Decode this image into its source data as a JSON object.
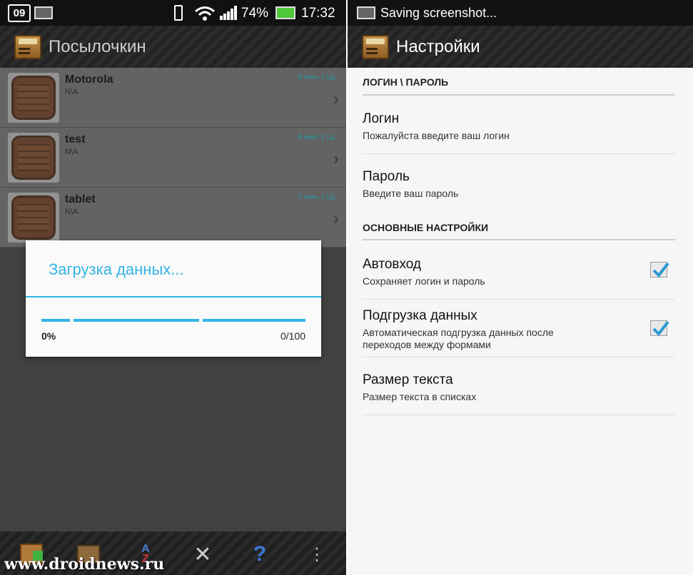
{
  "left": {
    "status": {
      "date_badge": "09",
      "battery": "74%",
      "time": "17:32"
    },
    "app_title": "Посылочкин",
    "items": [
      {
        "title": "Motorola",
        "subtitle": "N\\A",
        "time": "6 мин. | 1д."
      },
      {
        "title": "test",
        "subtitle": "N\\A",
        "time": "9 мин. | 1д."
      },
      {
        "title": "tablet",
        "subtitle": "N\\A",
        "time": "7 мин. | 1д."
      }
    ],
    "dialog": {
      "title": "Загрузка данных...",
      "percent": "0%",
      "count": "0/100"
    },
    "toolbar": [
      {
        "icon": "add-parcel-icon"
      },
      {
        "icon": "archive-icon"
      },
      {
        "icon": "sort-az-icon"
      },
      {
        "icon": "settings-tools-icon"
      },
      {
        "icon": "help-icon"
      },
      {
        "icon": "overflow-menu-icon"
      }
    ],
    "watermark": "www.droidnews.ru"
  },
  "right": {
    "status": {
      "text": "Saving screenshot..."
    },
    "app_title": "Настройки",
    "section_login": "ЛОГИН \\ ПАРОЛЬ",
    "login": {
      "title": "Логин",
      "summary": "Пожалуйста введите ваш логин"
    },
    "password": {
      "title": "Пароль",
      "summary": "Введите ваш пароль"
    },
    "section_main": "ОСНОВНЫЕ НАСТРОЙКИ",
    "autologin": {
      "title": "Автовход",
      "summary": "Сохраняет логин и пароль",
      "checked": true
    },
    "preload": {
      "title": "Подгрузка данных",
      "summary_line1": "Автоматическая подгрузка данных после",
      "summary_line2": "переходов между формами",
      "checked": true
    },
    "text_size": {
      "title": "Размер текста",
      "summary": "Размер текста в списках"
    }
  },
  "colors": {
    "accent": "#33b5e5",
    "time_label": "#2aa6b3",
    "battery": "#4fc83a"
  }
}
